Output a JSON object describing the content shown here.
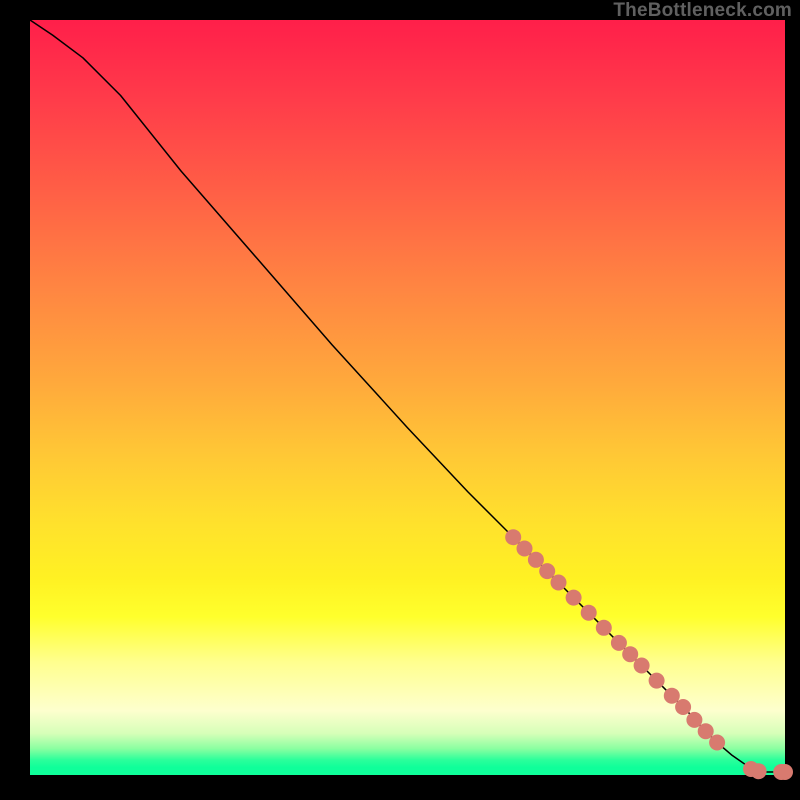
{
  "watermark": "TheBottleneck.com",
  "colors": {
    "dot": "#d87a6f",
    "curve": "#000000",
    "background": "#000000"
  },
  "chart_data": {
    "type": "line",
    "title": "",
    "xlabel": "",
    "ylabel": "",
    "xlim": [
      0,
      100
    ],
    "ylim": [
      0,
      100
    ],
    "series": [
      {
        "name": "curve",
        "x": [
          0,
          3,
          7,
          12,
          20,
          30,
          40,
          50,
          58,
          64,
          70,
          76,
          80,
          84,
          87,
          89,
          91,
          93,
          95,
          97,
          100
        ],
        "y": [
          100,
          98,
          95,
          90,
          80,
          68.5,
          57,
          46,
          37.5,
          31.5,
          25.5,
          19.5,
          15.5,
          11.5,
          8.5,
          6.3,
          4.3,
          2.6,
          1.2,
          0.4,
          0.4
        ]
      }
    ],
    "scatter": {
      "name": "dots",
      "points": [
        {
          "x": 64.0,
          "y": 31.5
        },
        {
          "x": 65.5,
          "y": 30.0
        },
        {
          "x": 67.0,
          "y": 28.5
        },
        {
          "x": 68.5,
          "y": 27.0
        },
        {
          "x": 70.0,
          "y": 25.5
        },
        {
          "x": 72.0,
          "y": 23.5
        },
        {
          "x": 74.0,
          "y": 21.5
        },
        {
          "x": 76.0,
          "y": 19.5
        },
        {
          "x": 78.0,
          "y": 17.5
        },
        {
          "x": 79.5,
          "y": 16.0
        },
        {
          "x": 81.0,
          "y": 14.5
        },
        {
          "x": 83.0,
          "y": 12.5
        },
        {
          "x": 85.0,
          "y": 10.5
        },
        {
          "x": 86.5,
          "y": 9.0
        },
        {
          "x": 88.0,
          "y": 7.3
        },
        {
          "x": 89.5,
          "y": 5.8
        },
        {
          "x": 91.0,
          "y": 4.3
        },
        {
          "x": 95.5,
          "y": 0.8
        },
        {
          "x": 96.5,
          "y": 0.5
        },
        {
          "x": 99.5,
          "y": 0.4
        },
        {
          "x": 100.0,
          "y": 0.4
        }
      ]
    }
  }
}
